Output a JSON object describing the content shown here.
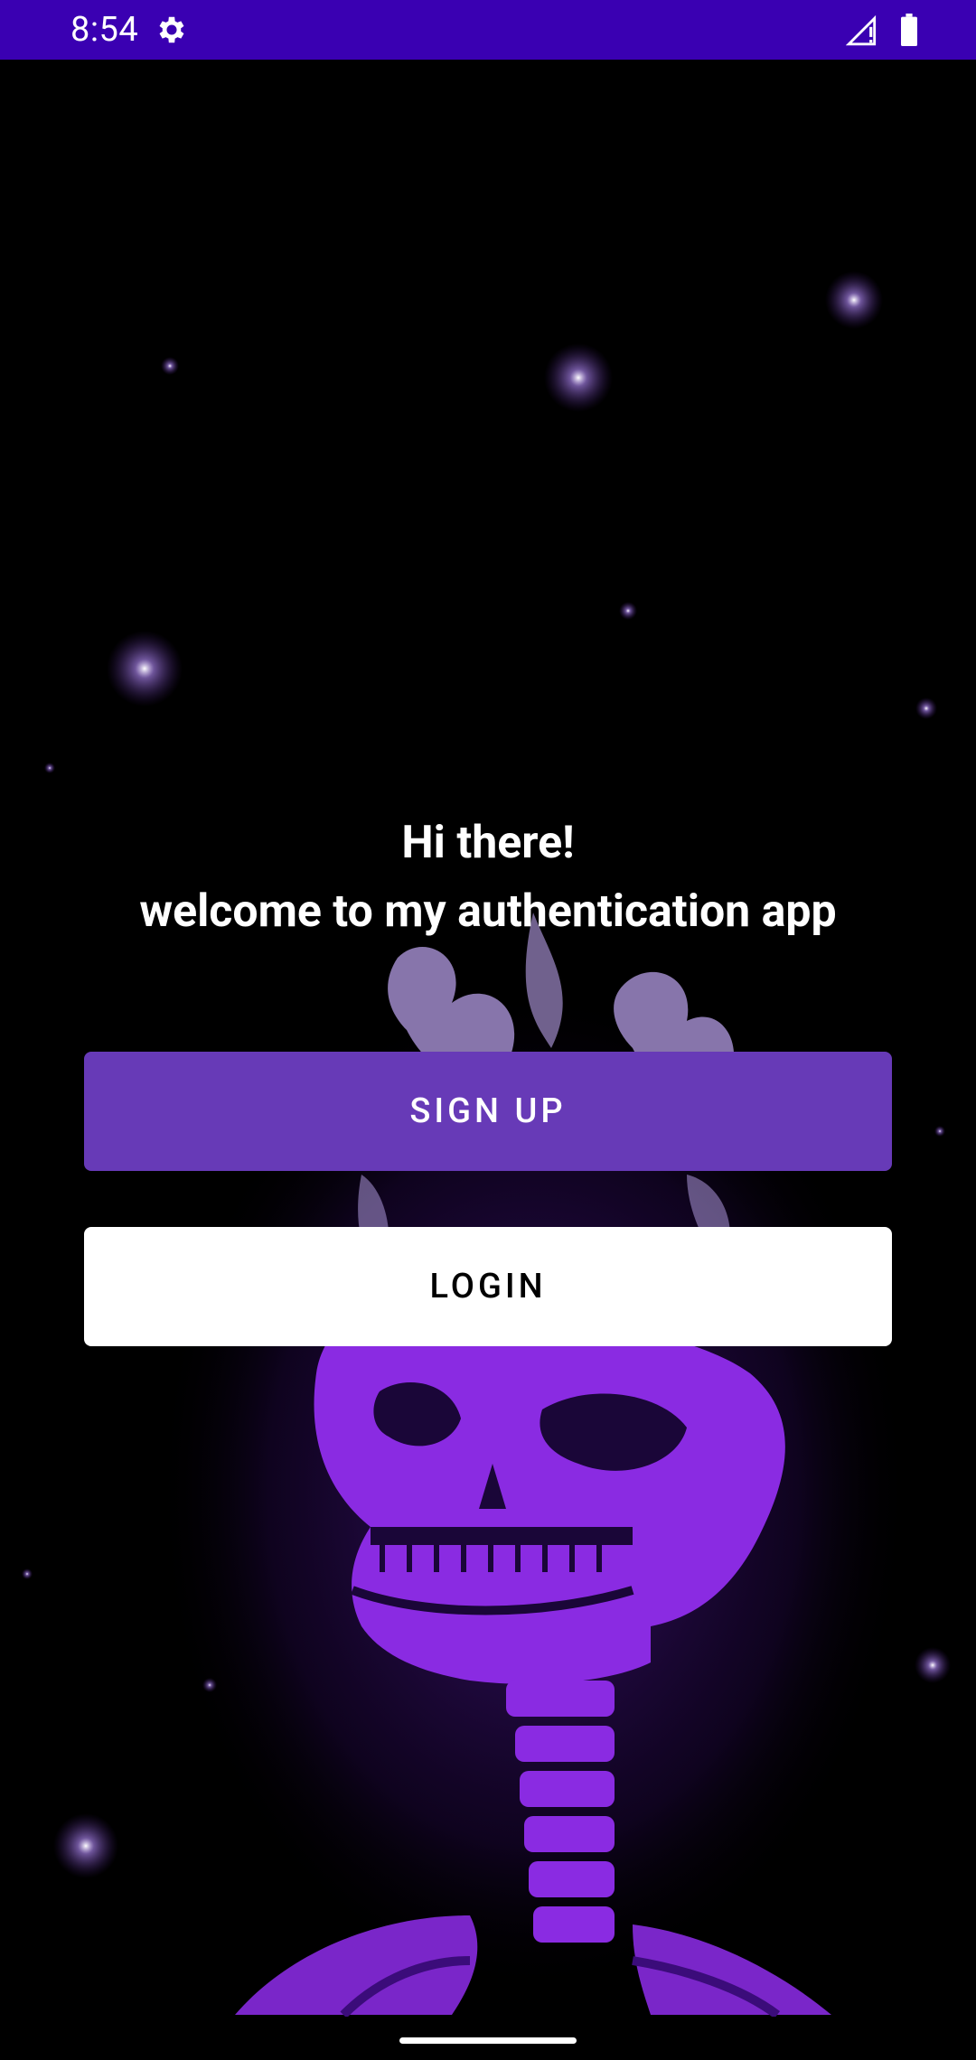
{
  "status_bar": {
    "time": "8:54",
    "icons": [
      "settings-icon",
      "signal-icon",
      "battery-icon"
    ],
    "color": "#3a00b2"
  },
  "welcome": {
    "line1": "Hi there!",
    "line2": "welcome to my authentication app"
  },
  "buttons": {
    "signup_label": "SIGN UP",
    "login_label": "LOGIN"
  },
  "colors": {
    "signup_bg": "#673ab7",
    "login_bg": "#ffffff",
    "illustration": "#8a2be2",
    "background": "#000000"
  }
}
